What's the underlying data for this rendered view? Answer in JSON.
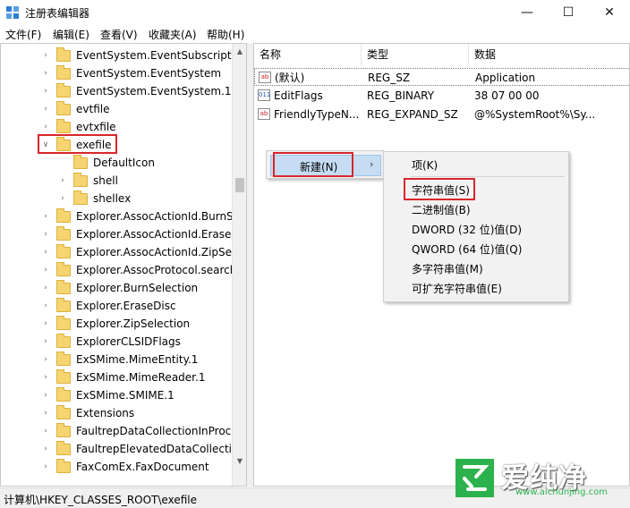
{
  "window": {
    "title": "注册表编辑器",
    "minimize_glyph": "—",
    "maximize_glyph": "☐",
    "close_glyph": "✕"
  },
  "menu": [
    "文件(F)",
    "编辑(E)",
    "查看(V)",
    "收藏夹(A)",
    "帮助(H)"
  ],
  "tree": {
    "items": [
      {
        "label": "EventSystem.EventSubscriptio",
        "level": 0,
        "expander": "›"
      },
      {
        "label": "EventSystem.EventSystem",
        "level": 0,
        "expander": "›"
      },
      {
        "label": "EventSystem.EventSystem.1",
        "level": 0,
        "expander": "›"
      },
      {
        "label": "evtfile",
        "level": 0,
        "expander": "›"
      },
      {
        "label": "evtxfile",
        "level": 0,
        "expander": "›"
      },
      {
        "label": "exefile",
        "level": 0,
        "expander": "∨",
        "open": true
      },
      {
        "label": "DefaultIcon",
        "level": 1,
        "expander": ""
      },
      {
        "label": "shell",
        "level": 1,
        "expander": "›"
      },
      {
        "label": "shellex",
        "level": 1,
        "expander": "›"
      },
      {
        "label": "Explorer.AssocActionId.BurnSe",
        "level": 0,
        "expander": "›"
      },
      {
        "label": "Explorer.AssocActionId.EraseD",
        "level": 0,
        "expander": "›"
      },
      {
        "label": "Explorer.AssocActionId.ZipSele",
        "level": 0,
        "expander": "›"
      },
      {
        "label": "Explorer.AssocProtocol.search",
        "level": 0,
        "expander": "›"
      },
      {
        "label": "Explorer.BurnSelection",
        "level": 0,
        "expander": "›"
      },
      {
        "label": "Explorer.EraseDisc",
        "level": 0,
        "expander": "›"
      },
      {
        "label": "Explorer.ZipSelection",
        "level": 0,
        "expander": "›"
      },
      {
        "label": "ExplorerCLSIDFlags",
        "level": 0,
        "expander": "›"
      },
      {
        "label": "ExSMime.MimeEntity.1",
        "level": 0,
        "expander": "›"
      },
      {
        "label": "ExSMime.MimeReader.1",
        "level": 0,
        "expander": "›"
      },
      {
        "label": "ExSMime.SMIME.1",
        "level": 0,
        "expander": "›"
      },
      {
        "label": "Extensions",
        "level": 0,
        "expander": "›"
      },
      {
        "label": "FaultrepDataCollectionInProc",
        "level": 0,
        "expander": "›"
      },
      {
        "label": "FaultrepElevatedDataCollection",
        "level": 0,
        "expander": "›"
      },
      {
        "label": "FaxComEx.FaxDocument",
        "level": 0,
        "expander": "›"
      }
    ]
  },
  "list": {
    "columns": [
      "名称",
      "类型",
      "数据"
    ],
    "rows": [
      {
        "icon": "ab",
        "name": "(默认)",
        "type": "REG_SZ",
        "data": "Application"
      },
      {
        "icon": "bin",
        "name": "EditFlags",
        "type": "REG_BINARY",
        "data": "38 07 00 00"
      },
      {
        "icon": "ab",
        "name": "FriendlyTypeN...",
        "type": "REG_EXPAND_SZ",
        "data": "@%SystemRoot%\\Sy..."
      }
    ]
  },
  "context_menu": {
    "new_label": "新建(N)",
    "arrow": "›"
  },
  "submenu": {
    "items": [
      "项(K)",
      "字符串值(S)",
      "二进制值(B)",
      "DWORD (32 位)值(D)",
      "QWORD (64 位)值(Q)",
      "多字符串值(M)",
      "可扩充字符串值(E)"
    ]
  },
  "status_bar": {
    "path": "计算机\\HKEY_CLASSES_ROOT\\exefile"
  },
  "watermark": {
    "title": "爱纯净",
    "url": "www.aichunjing.com"
  },
  "colors": {
    "highlight_border": "#d8262c",
    "menu_selection": "#c5dcf3",
    "folder": "#f5d471",
    "watermark_green": "#2bb24c"
  }
}
